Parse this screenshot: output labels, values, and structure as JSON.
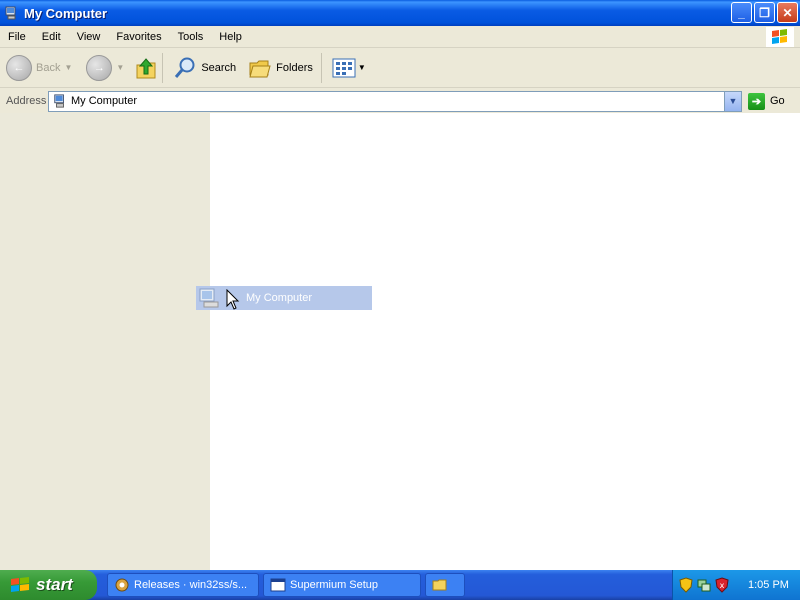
{
  "window": {
    "title": "My Computer",
    "buttons": {
      "minimize": "_",
      "maximize": "❐",
      "close": "✕"
    }
  },
  "menu": {
    "items": [
      "File",
      "Edit",
      "View",
      "Favorites",
      "Tools",
      "Help"
    ]
  },
  "toolbar": {
    "back_label": "Back",
    "search_label": "Search",
    "folders_label": "Folders"
  },
  "address": {
    "label": "Address",
    "value": "My Computer",
    "go_label": "Go"
  },
  "drag_item": {
    "label": "My Computer"
  },
  "taskbar": {
    "start_label": "start",
    "tasks": [
      {
        "label": "Releases · win32ss/s...",
        "icon": "browser-icon"
      },
      {
        "label": "Supermium Setup",
        "icon": "window-icon"
      },
      {
        "label": "",
        "icon": "folder-icon"
      }
    ],
    "clock": "1:05 PM"
  },
  "colors": {
    "titlebar": "#0a5be4",
    "taskbar": "#245edb",
    "start": "#379a37",
    "drag_highlight": "#b6c8ea"
  }
}
